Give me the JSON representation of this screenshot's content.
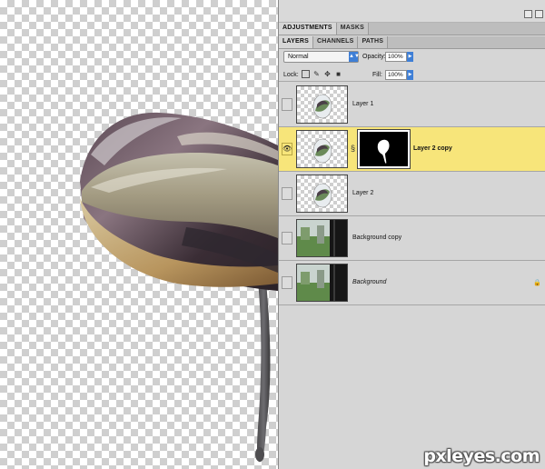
{
  "panel": {
    "tabs_top": [
      "ADJUSTMENTS",
      "MASKS"
    ],
    "tabs_layers": [
      "LAYERS",
      "CHANNELS",
      "PATHS"
    ],
    "blend_mode": "Normal",
    "opacity_label": "Opacity:",
    "opacity_value": "100%",
    "lock_label": "Lock:",
    "fill_label": "Fill:",
    "fill_value": "100%"
  },
  "layers": [
    {
      "name": "Layer 1",
      "visible": false,
      "selected": false,
      "has_mask": false,
      "thumb": "snail-small"
    },
    {
      "name": "Layer 2 copy",
      "visible": true,
      "selected": true,
      "has_mask": true,
      "thumb": "snail-small"
    },
    {
      "name": "Layer 2",
      "visible": false,
      "selected": false,
      "has_mask": false,
      "thumb": "snail-small"
    },
    {
      "name": "Background copy",
      "visible": false,
      "selected": false,
      "has_mask": false,
      "thumb": "photo-window"
    },
    {
      "name": "Background",
      "visible": false,
      "selected": false,
      "has_mask": false,
      "locked": true,
      "thumb": "photo-window"
    }
  ],
  "icons": {
    "eye": "eye-icon",
    "chain": "chain-link-icon",
    "lock": "lock-icon"
  },
  "colors": {
    "selected_row": "#f7e57a",
    "panel_bg": "#d6d6d6",
    "accent_blue": "#3f7fd6"
  },
  "watermark": "pxleyes.com"
}
